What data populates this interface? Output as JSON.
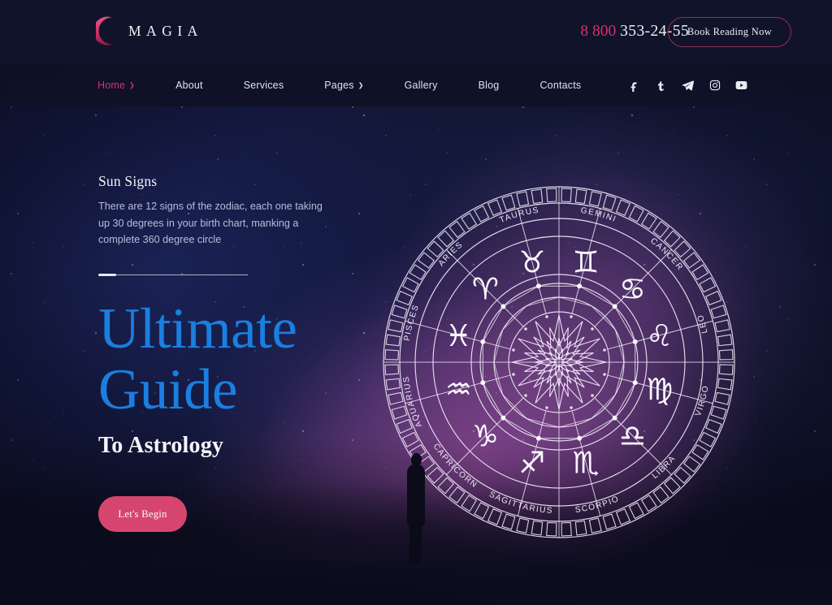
{
  "header": {
    "logo_text": "MAGIA",
    "logo_icon": "crescent-moon-icon",
    "phone_prefix": "8 800",
    "phone_number": "353-24-55",
    "cta_label": "Book Reading Now",
    "accent_pink": "#d6316b"
  },
  "nav": {
    "items": [
      {
        "label": "Home",
        "active": true,
        "caret": "❯"
      },
      {
        "label": "About",
        "active": false,
        "caret": ""
      },
      {
        "label": "Services",
        "active": false,
        "caret": ""
      },
      {
        "label": "Pages",
        "active": false,
        "caret": "❯"
      },
      {
        "label": "Gallery",
        "active": false,
        "caret": ""
      },
      {
        "label": "Blog",
        "active": false,
        "caret": ""
      },
      {
        "label": "Contacts",
        "active": false,
        "caret": ""
      }
    ],
    "socials": [
      {
        "name": "facebook-icon",
        "glyph": "f"
      },
      {
        "name": "tumblr-icon",
        "glyph": "t"
      },
      {
        "name": "telegram-icon",
        "glyph": "➤"
      },
      {
        "name": "instagram-icon",
        "glyph": "▢"
      },
      {
        "name": "youtube-icon",
        "glyph": "▶"
      }
    ]
  },
  "hero": {
    "eyebrow_title": "Sun Signs",
    "description": "There are 12 signs of the zodiac, each one taking up 30 degrees in your birth chart, manking a complete 360 degree circle",
    "headline_line1": "Ultimate",
    "headline_line2": "Guide",
    "subheadline": "To Astrology",
    "cta_label": "Let's Begin",
    "headline_color": "#1a7fe0",
    "cta_color": "#d6456e"
  },
  "zodiac_wheel": {
    "signs": [
      {
        "name": "PISCES",
        "symbol": "♓",
        "angle": -75
      },
      {
        "name": "ARIES",
        "symbol": "♈",
        "angle": -45
      },
      {
        "name": "TAURUS",
        "symbol": "♉",
        "angle": -15
      },
      {
        "name": "GEMINI",
        "symbol": "♊",
        "angle": 15
      },
      {
        "name": "CANCER",
        "symbol": "♋",
        "angle": 45
      },
      {
        "name": "LEO",
        "symbol": "♌",
        "angle": 75
      },
      {
        "name": "VIRGO",
        "symbol": "♍",
        "angle": 105
      },
      {
        "name": "LIBRA",
        "symbol": "♎",
        "angle": 135
      },
      {
        "name": "SCORPIO",
        "symbol": "♏",
        "angle": 165
      },
      {
        "name": "SAGITTARIUS",
        "symbol": "♐",
        "angle": 195
      },
      {
        "name": "CAPRICORN",
        "symbol": "♑",
        "angle": 225
      },
      {
        "name": "AQUARIUS",
        "symbol": "♒",
        "angle": 255
      }
    ]
  }
}
